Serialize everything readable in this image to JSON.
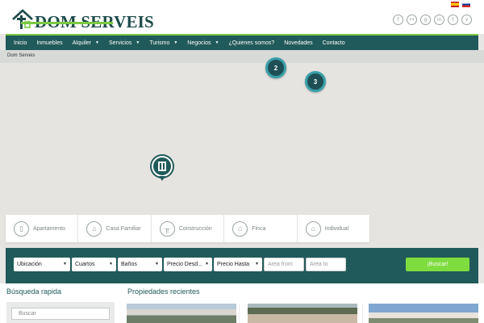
{
  "header": {
    "logo_text": "DOM SERVEIS",
    "social_icons": [
      "facebook-icon",
      "flickr-icon",
      "google-plus-icon",
      "linkedin-icon",
      "tumblr-icon",
      "vimeo-icon"
    ],
    "languages": [
      "es",
      "ru"
    ]
  },
  "nav": {
    "items": [
      {
        "label": "Inicio",
        "dropdown": false
      },
      {
        "label": "Inmuebles",
        "dropdown": false
      },
      {
        "label": "Alquiler",
        "dropdown": true
      },
      {
        "label": "Servicios",
        "dropdown": true
      },
      {
        "label": "Turismo",
        "dropdown": true
      },
      {
        "label": "Negocios",
        "dropdown": true
      },
      {
        "label": "¿Quienes somos?",
        "dropdown": false
      },
      {
        "label": "Novedades",
        "dropdown": false
      },
      {
        "label": "Contacto",
        "dropdown": false
      }
    ]
  },
  "breadcrumb": "Dom Serveis",
  "map": {
    "clusters": [
      "2",
      "3"
    ]
  },
  "categories": [
    {
      "label": "Apartamento",
      "icon": "apartment-icon"
    },
    {
      "label": "Casa Familiar",
      "icon": "house-icon"
    },
    {
      "label": "Construcción",
      "icon": "construction-icon"
    },
    {
      "label": "Finca",
      "icon": "farm-icon"
    },
    {
      "label": "Individual",
      "icon": "home-icon"
    }
  ],
  "search": {
    "ubicacion": "Ubicación",
    "cuartos": "Cuartos",
    "banos": "Baños",
    "precio_desde": "Precio Desd...",
    "precio_hasta": "Precio Hasta",
    "area_from_placeholder": "Area from",
    "area_to_placeholder": "Area to",
    "button": "¡Buscar!"
  },
  "quick_search": {
    "title": "Búsqueda rapida",
    "placeholder": "Buscar"
  },
  "recent": {
    "title": "Propiedades recientes"
  },
  "colors": {
    "primary": "#215a5a",
    "accent": "#7ac943",
    "button": "#7fdc3f"
  }
}
